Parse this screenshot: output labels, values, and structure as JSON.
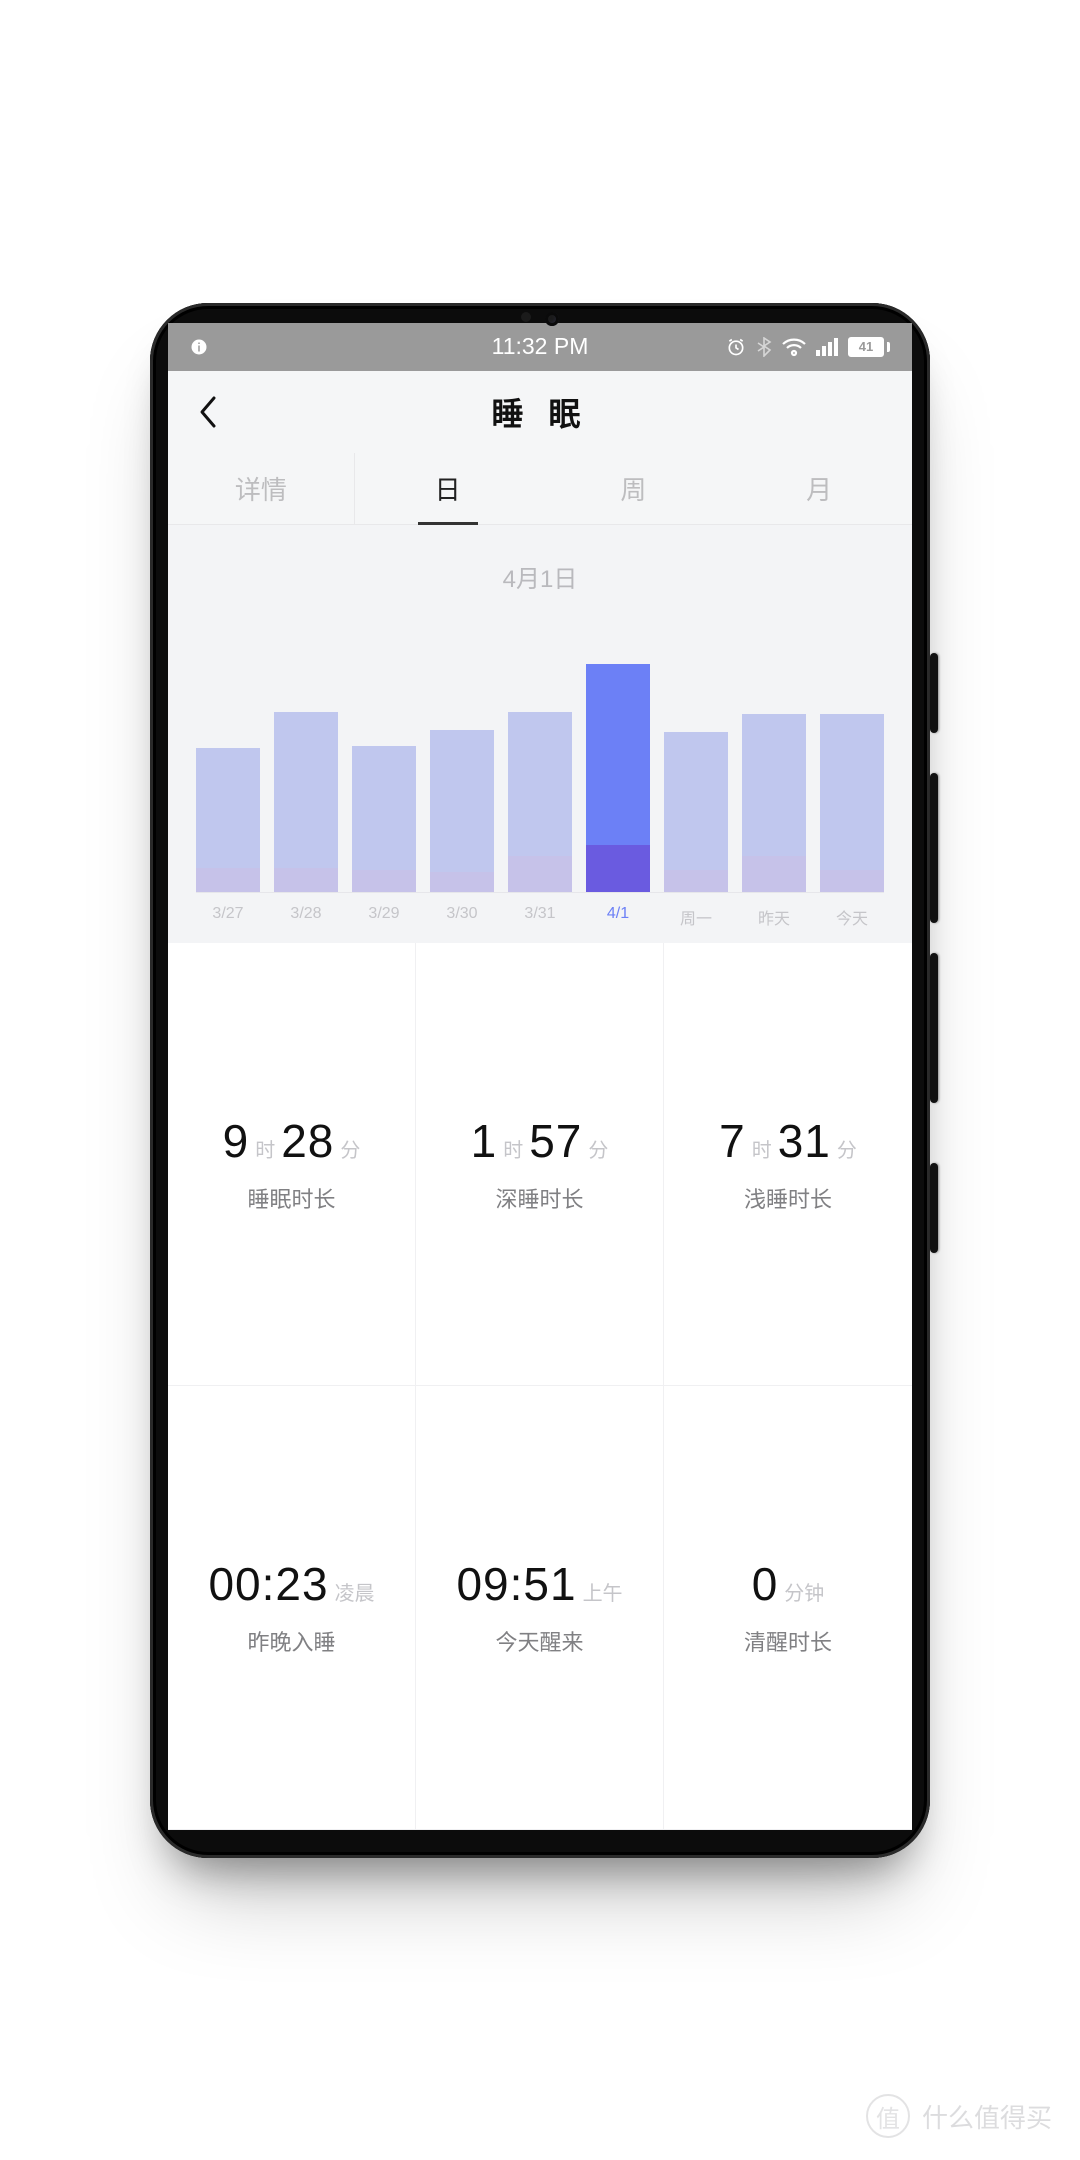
{
  "status": {
    "time": "11:32 PM",
    "battery": "41"
  },
  "header": {
    "title": "睡 眠"
  },
  "tabs": {
    "items": [
      "详情",
      "日",
      "周",
      "月"
    ],
    "activeIndex": 1
  },
  "chart_section": {
    "date_label": "4月1日"
  },
  "chart_data": {
    "type": "bar",
    "title": "4月1日",
    "xlabel": "",
    "ylabel": "",
    "ylim": [
      0,
      600
    ],
    "categories": [
      "3/27",
      "3/28",
      "3/29",
      "3/30",
      "3/31",
      "4/1",
      "周一",
      "昨天",
      "今天"
    ],
    "active_index": 5,
    "series": [
      {
        "name": "浅睡(分钟)",
        "values": [
          300,
          390,
          310,
          355,
          360,
          451,
          345,
          355,
          390
        ]
      },
      {
        "name": "深睡(分钟)",
        "values": [
          60,
          60,
          55,
          50,
          90,
          117,
          55,
          90,
          55
        ]
      }
    ]
  },
  "metrics": [
    {
      "parts": [
        {
          "v": "9",
          "u": "时"
        },
        {
          "v": "28",
          "u": "分"
        }
      ],
      "label": "睡眠时长"
    },
    {
      "parts": [
        {
          "v": "1",
          "u": "时"
        },
        {
          "v": "57",
          "u": "分"
        }
      ],
      "label": "深睡时长"
    },
    {
      "parts": [
        {
          "v": "7",
          "u": "时"
        },
        {
          "v": "31",
          "u": "分"
        }
      ],
      "label": "浅睡时长"
    },
    {
      "parts": [
        {
          "v": "00:23",
          "u": "凌晨"
        }
      ],
      "label": "昨晚入睡"
    },
    {
      "parts": [
        {
          "v": "09:51",
          "u": "上午"
        }
      ],
      "label": "今天醒来"
    },
    {
      "parts": [
        {
          "v": "0",
          "u": "分钟"
        }
      ],
      "label": "清醒时长"
    }
  ],
  "watermark": {
    "logo": "值",
    "text": "什么值得买"
  }
}
